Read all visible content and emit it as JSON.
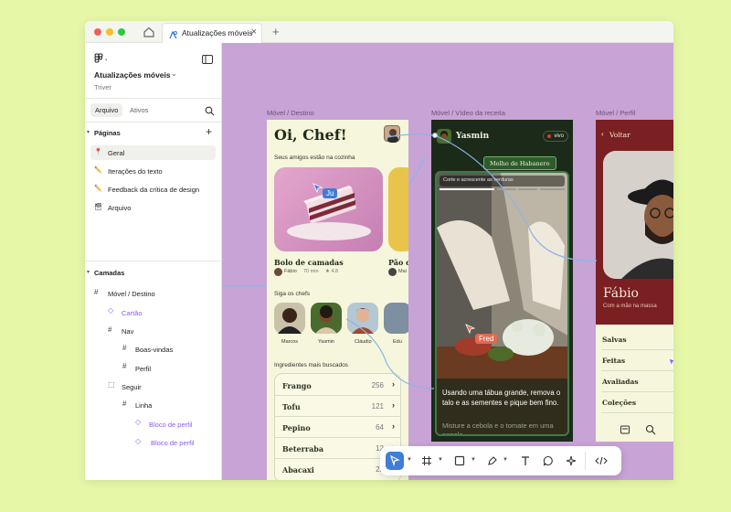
{
  "window": {
    "tab_title": "Atualizações móveis",
    "tab_add": "+",
    "tab_close": "×"
  },
  "sidebar": {
    "file_name": "Atualizações móveis",
    "team": "Trivet",
    "tabs": [
      "Arquivo",
      "Ativos"
    ],
    "pages_heading": "Páginas",
    "pages": [
      "Geral",
      "Iterações do texto",
      "Feedback da crítica de design",
      "Arquivo"
    ],
    "layers_heading": "Camadas",
    "layers": [
      "Móvel / Destino",
      "Cartão",
      "Nav",
      "Boas-vindas",
      "Perfil",
      "Seguir",
      "Linha",
      "Bloco de perfil",
      "Bloco de perfil"
    ]
  },
  "frames": {
    "destino_label": "Móvel / Destino",
    "video_label": "Móvel / Vídeo da receita",
    "perfil_label": "Móvel / Perfil"
  },
  "destino": {
    "greeting": "Oi, Chef!",
    "friends_heading": "Seus amigos estão na cozinha",
    "cursor_name": "Ju",
    "card1_title": "Bolo de camadas",
    "card1_author": "Fábio",
    "card1_meta": "70 min",
    "card1_rating": "★ 4.8",
    "card2_title": "Pão d",
    "card2_author": "Mai",
    "follow_heading": "Siga os chefs",
    "chefs": [
      "Marcos",
      "Yasmin",
      "Cláudio",
      "Edu"
    ],
    "ingredients_heading": "Ingredientes mais buscados",
    "ingredients": [
      {
        "name": "Frango",
        "count": "256"
      },
      {
        "name": "Tofu",
        "count": "121"
      },
      {
        "name": "Pepino",
        "count": "64"
      },
      {
        "name": "Beterraba",
        "count": "12"
      },
      {
        "name": "Abacaxi",
        "count": "22"
      }
    ]
  },
  "video": {
    "user": "Yasmin",
    "live": "vivo",
    "recipe": "Molho de Habanero",
    "step": "Corte e acrescente as verduras",
    "cursor_name": "Fred",
    "caption": "Usando uma tábua grande, remova o talo e as sementes e pique bem fino.",
    "caption2": "Misture a cebola e o tomate em uma panela"
  },
  "perfil": {
    "back": "Voltar",
    "name": "Fábio",
    "subtitle": "Com a mão na massa",
    "menu": [
      "Salvas",
      "Feitas",
      "Avaliadas",
      "Coleções"
    ]
  },
  "colors": {
    "canvas": "#c8a3d6",
    "cream": "#f6f6dc",
    "dark_green": "#1c2a1a",
    "maroon": "#7a1f22",
    "cursor_blue": "#3f7dd6",
    "cursor_red": "#e26a50",
    "accent_purple": "#8b5cf6"
  }
}
